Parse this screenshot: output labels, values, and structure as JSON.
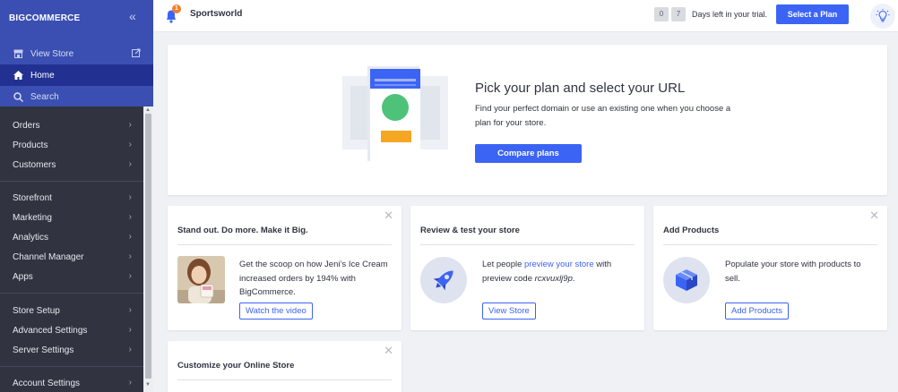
{
  "brand": {
    "logo_text": "BIGCOMMERCE",
    "accent": "#3c64f4",
    "sidebar_bg": "#313440",
    "sidebar_top_bg": "#3a4fb1",
    "badge_color": "#f07e29"
  },
  "sidebar": {
    "collapse_icon": "double-chevron-left-icon",
    "top_items": [
      {
        "label": "View Store",
        "icon": "storefront-icon",
        "external": true
      },
      {
        "label": "Home",
        "icon": "home-icon",
        "active": true
      },
      {
        "label": "Search",
        "icon": "search-icon"
      }
    ],
    "groups": [
      [
        "Orders",
        "Products",
        "Customers"
      ],
      [
        "Storefront",
        "Marketing",
        "Analytics",
        "Channel Manager",
        "Apps"
      ],
      [
        "Store Setup",
        "Advanced Settings",
        "Server Settings"
      ],
      [
        "Account Settings"
      ]
    ]
  },
  "header": {
    "notification_count": "1",
    "store_name": "Sportsworld",
    "trial_days": [
      "0",
      "7"
    ],
    "trial_text": "Days left in your trial.",
    "select_plan_label": "Select a Plan",
    "help_icon": "lightbulb-icon"
  },
  "hero": {
    "title": "Pick your plan and select your URL",
    "description": "Find your perfect domain or use an existing one when you choose a plan for your store.",
    "button_label": "Compare plans"
  },
  "tiles": [
    {
      "title": "Stand out. Do more. Make it Big.",
      "text": "Get the scoop on how Jeni’s Ice Cream increased orders by 194% with BigCommerce.",
      "button_label": "Watch the video",
      "closable": true
    },
    {
      "title": "Review & test your store",
      "text_before": "Let people ",
      "link_text": "preview your store",
      "text_middle": " with preview code ",
      "preview_code": "rcxvuxlj9p",
      "text_after": ".",
      "button_label": "View Store",
      "closable": false
    },
    {
      "title": "Add Products",
      "text": "Populate your store with products to sell.",
      "button_label": "Add Products",
      "closable": true
    },
    {
      "title": "Customize your Online Store",
      "closable": true
    }
  ]
}
